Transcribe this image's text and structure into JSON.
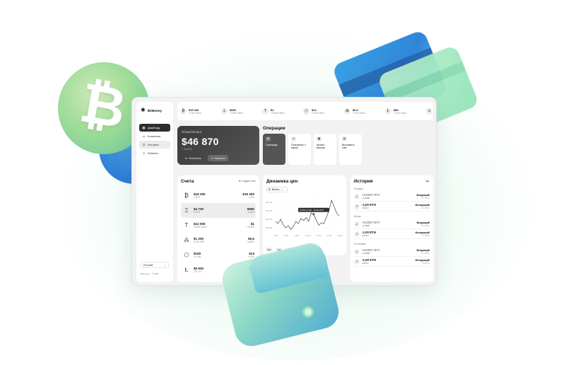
{
  "app": {
    "name": "BitMoney",
    "logo_icon": "sparkle-icon"
  },
  "sidebar": {
    "items": [
      {
        "label": "Дашборд",
        "icon": "dashboard-icon"
      },
      {
        "label": "Кошельки",
        "icon": "wallet-icon"
      },
      {
        "label": "История",
        "icon": "clock-icon"
      },
      {
        "label": "Кабинет",
        "icon": "user-icon"
      }
    ],
    "language": "Русский",
    "copyright": "Bitmoney",
    "copyright_year": "© 2024"
  },
  "ticker": [
    {
      "icon": "₿",
      "price": "$19 200",
      "change": "+0,3% 24hrs"
    },
    {
      "icon": "Ξ",
      "price": "$590",
      "change": "-3,36% 24hrs"
    },
    {
      "icon": "T",
      "price": "$1",
      "change": "+0,05% 24hrs"
    },
    {
      "icon": "⬡",
      "price": "$13",
      "change": "+0,3% 24hrs"
    },
    {
      "icon": "⁂",
      "price": "$0.6",
      "change": "+0,3% 24hrs"
    },
    {
      "icon": "Ł",
      "price": "$80",
      "change": "+0,3% 24hrs"
    },
    {
      "icon": "Ξ",
      "price": "$6..",
      "change": "+0,3%"
    }
  ],
  "balance": {
    "label": "Общий баланс",
    "amount": "$46 870",
    "change": "+ 3,6 $72",
    "topup_label": "Пополнить",
    "withdraw_label": "Вывести"
  },
  "operations": {
    "title": "Операции",
    "items": [
      {
        "label": "Переводы",
        "icon": "transfer-icon"
      },
      {
        "label": "Пополнить с карты",
        "icon": "card-icon"
      },
      {
        "label": "Купить валюту",
        "icon": "wallet-icon"
      },
      {
        "label": "Выставить счет",
        "icon": "document-icon"
      }
    ]
  },
  "accounts": {
    "title": "Счета",
    "add_label": "Создать счет",
    "rows": [
      {
        "icon": "₿",
        "amount": "$19 200",
        "sub": "1 BTC",
        "value": "$19 200",
        "change": "+0,3%"
      },
      {
        "icon": "Ξ",
        "amount": "$4 720",
        "sub": "8 ETH",
        "value": "$590",
        "change": "-3,26%"
      },
      {
        "icon": "T",
        "amount": "$12 000",
        "sub": "12 000 USDT",
        "value": "$1",
        "change": "+0,05%"
      },
      {
        "icon": "⁂",
        "amount": "$1 200",
        "sub": "2 000 XRP",
        "value": "$0.6",
        "change": "+4,28%"
      },
      {
        "icon": "⬡",
        "amount": "$150",
        "sub": "12 Link",
        "value": "$13",
        "change": "+0,3%"
      },
      {
        "icon": "Ł",
        "amount": "$9 600",
        "sub": "120 LTC",
        "value": "$80",
        "change": "+0,3%"
      }
    ]
  },
  "dynamics": {
    "title": "Динамика цен",
    "coin": "Bitcoin",
    "tooltip": "19 200 (+0,3%) · 12 Фев 2024",
    "periods": [
      "Мес",
      "Год",
      "5л",
      "Макс",
      "День",
      "Нед"
    ]
  },
  "chart_data": {
    "type": "line",
    "title": "Динамика цен",
    "y_ticks": [
      "$20 400",
      "$20 200",
      "$20 000",
      "$19 800"
    ],
    "x_ticks": [
      "7 Фев",
      "8 Фев",
      "9 Фев",
      "10 Фев",
      "11 Фев",
      "12 Фев",
      "13 Фев"
    ],
    "ylim": [
      19700,
      20500
    ],
    "x": [
      0,
      1,
      2,
      3,
      4,
      5,
      6,
      7,
      8,
      9,
      10,
      11,
      12,
      13,
      14,
      15,
      16,
      17,
      18,
      19,
      20,
      21,
      22,
      23,
      24,
      25
    ],
    "values": [
      19950,
      19900,
      20000,
      19870,
      19800,
      19850,
      19760,
      19830,
      19950,
      19900,
      20020,
      19970,
      20040,
      19950,
      20150,
      20120,
      19980,
      19860,
      19920,
      19900,
      20050,
      20200,
      20450,
      20300,
      20150,
      20080
    ],
    "grid": true
  },
  "history": {
    "title": "История",
    "groups": [
      {
        "day": "Сегодня",
        "items": [
          {
            "amount": "+0,0057 BTC",
            "sub": "+3 000₽",
            "type": "Входящий",
            "time": "11:14PM",
            "dir": "in"
          },
          {
            "amount": "-1,00 ETH",
            "sub": "-8 ETH",
            "type": "Исходящий",
            "time": "11:02PM",
            "dir": "out"
          }
        ]
      },
      {
        "day": "Вчера",
        "items": [
          {
            "amount": "+0,0057 BTC",
            "sub": "+3 000₽",
            "type": "Входящий",
            "time": "10:14PM",
            "dir": "in"
          },
          {
            "amount": "-1,00 ETH",
            "sub": "-8 ETH",
            "type": "Исходящий",
            "time": "9:02PM",
            "dir": "out"
          }
        ]
      },
      {
        "day": "24 Ноября",
        "items": [
          {
            "amount": "+0,0057 BTC",
            "sub": "+3 000₽",
            "type": "Входящий",
            "time": "10:14PM",
            "dir": "in"
          },
          {
            "amount": "-1,00 ETH",
            "sub": "-8 ETH",
            "type": "Исходящий",
            "time": "8:02PM",
            "dir": "out"
          }
        ]
      }
    ]
  },
  "decor": {
    "btc_symbol": "₿"
  }
}
